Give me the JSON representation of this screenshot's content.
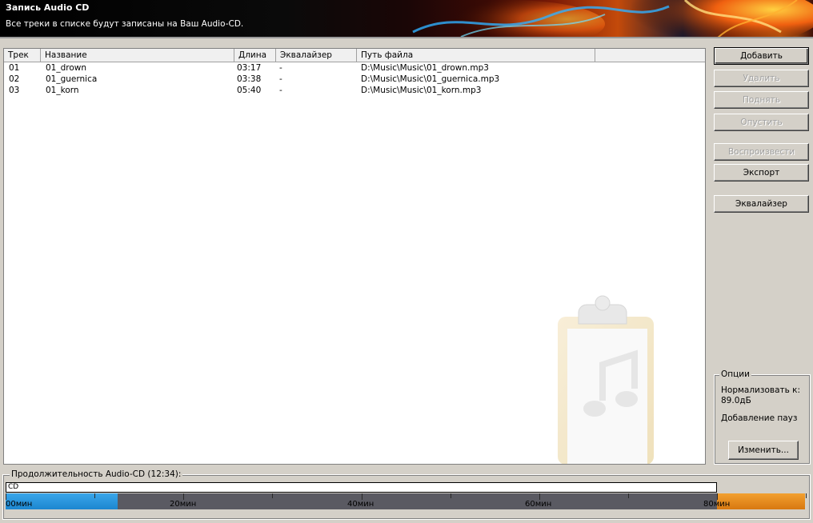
{
  "header": {
    "title": "Запись Audio CD",
    "subtitle": "Все треки в списке будут записаны на Ваш Audio-CD."
  },
  "list": {
    "columns": [
      "Трек",
      "Название",
      "Длина",
      "Эквалайзер",
      "Путь файла"
    ],
    "rows": [
      {
        "track": "01",
        "name": "01_drown",
        "length": "03:17",
        "eq": "-",
        "path": "D:\\Music\\Music\\01_drown.mp3"
      },
      {
        "track": "02",
        "name": "01_guernica",
        "length": "03:38",
        "eq": "-",
        "path": "D:\\Music\\Music\\01_guernica.mp3"
      },
      {
        "track": "03",
        "name": "01_korn",
        "length": "05:40",
        "eq": "-",
        "path": "D:\\Music\\Music\\01_korn.mp3"
      }
    ]
  },
  "buttons": {
    "add": "Добавить",
    "remove": "Удалить",
    "up": "Поднять",
    "down": "Опустить",
    "play": "Воспроизвести",
    "export": "Экспорт",
    "equalizer": "Эквалайзер"
  },
  "options": {
    "title": "Опции",
    "normalize_line1": "Нормализовать к:",
    "normalize_line2": "89.0дБ",
    "pauses": "Добавление пауз",
    "change": "Изменить..."
  },
  "duration": {
    "title": "Продолжительность Audio-CD (12:34):",
    "cd_label": "CD",
    "scale_labels": [
      "00мин",
      "20мин",
      "40мин",
      "60мин",
      "80мин"
    ],
    "used_minutes": 12.57,
    "scale_max_minutes": 90
  },
  "colors": {
    "used": "#1c86d0",
    "over": "#e08418",
    "scale": "#5a5a62"
  }
}
